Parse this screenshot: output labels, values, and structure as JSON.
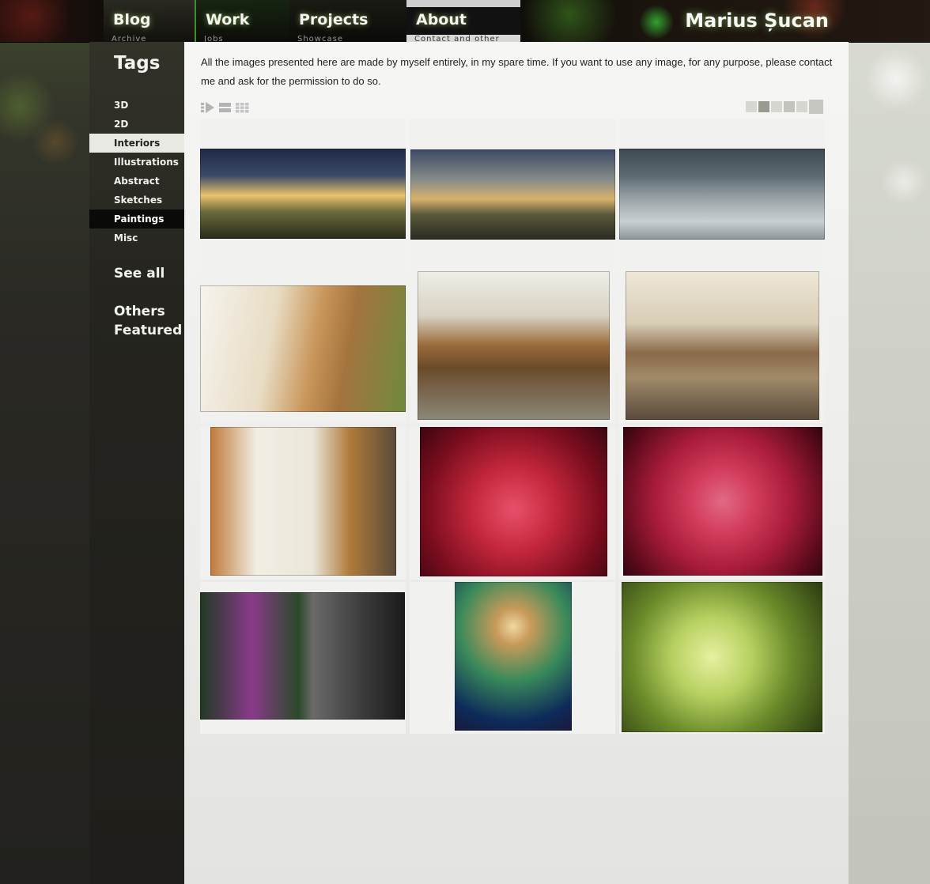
{
  "site": {
    "brand": "Marius Șucan"
  },
  "nav": {
    "items": [
      {
        "id": "blog",
        "label": "Blog",
        "strip": "Archive"
      },
      {
        "id": "work",
        "label": "Work",
        "strip": "Jobs"
      },
      {
        "id": "projects",
        "label": "Projects",
        "strip": "Showcase"
      },
      {
        "id": "about",
        "label": "About",
        "strip": "Contact and other"
      }
    ]
  },
  "sidebar": {
    "title": "Tags",
    "tags": [
      {
        "label": "3D",
        "state": "normal"
      },
      {
        "label": "2D",
        "state": "normal"
      },
      {
        "label": "Interiors",
        "state": "selected"
      },
      {
        "label": "Illustrations",
        "state": "normal"
      },
      {
        "label": "Abstract",
        "state": "normal"
      },
      {
        "label": "Sketches",
        "state": "normal"
      },
      {
        "label": "Paintings",
        "state": "hover"
      },
      {
        "label": "Misc",
        "state": "normal"
      }
    ],
    "see_all": "See all",
    "others_featured": "Others Featured"
  },
  "main": {
    "intro": "All the images presented here are made by myself entirely, in my spare time. If you want to use any image, for any purpose, please contact me and ask for the permission to do so.",
    "view_icons": [
      "slideshow-view-icon",
      "list-view-icon",
      "grid-view-icon"
    ],
    "thumb_sizes": {
      "count": 6,
      "selected_index": 1
    }
  },
  "gallery": {
    "thumbs": [
      {
        "name": "autumn-night-church-panorama",
        "palette": [
          "#1e2a45",
          "#6b6a3c",
          "#e9c36b",
          "#3a3a24"
        ]
      },
      {
        "name": "dusk-church-panorama",
        "palette": [
          "#3b4a66",
          "#8b8d88",
          "#d8b26b",
          "#3b3a2c"
        ]
      },
      {
        "name": "winter-church-panorama",
        "palette": [
          "#5e6a72",
          "#9aa3a6",
          "#c8d0d2",
          "#2f373c"
        ]
      },
      {
        "name": "dining-room-interior",
        "palette": [
          "#f2efe8",
          "#d9b98a",
          "#a4743e",
          "#6e8a3d"
        ]
      },
      {
        "name": "piano-room-interior",
        "palette": [
          "#ecebe4",
          "#9a6a3a",
          "#6a4a2a",
          "#8c8878"
        ]
      },
      {
        "name": "living-room-armchairs",
        "palette": [
          "#ece6d6",
          "#8a6a4a",
          "#a08a6a",
          "#5a4a3a"
        ]
      },
      {
        "name": "living-room-window",
        "palette": [
          "#eae6da",
          "#b07a3a",
          "#7a5a3e",
          "#5a4a3a"
        ]
      },
      {
        "name": "red-hearts-abstract",
        "palette": [
          "#7a0d1e",
          "#c2263b",
          "#e8506a",
          "#3a0610"
        ]
      },
      {
        "name": "red-rose-abstract",
        "palette": [
          "#5a0a1a",
          "#a81c3a",
          "#d43d5e",
          "#2e0610"
        ]
      },
      {
        "name": "fantasy-shoe-diptych",
        "palette": [
          "#2a4a2a",
          "#8a3a8a",
          "#6a6a6a",
          "#1a1a1a"
        ]
      },
      {
        "name": "glowing-mushroom",
        "palette": [
          "#0d2a5a",
          "#3a8a5a",
          "#c89a5a",
          "#1a1a3a"
        ]
      },
      {
        "name": "green-bubbles-abstract",
        "palette": [
          "#4a6a1a",
          "#b6d060",
          "#e8f0a0",
          "#2a3a10"
        ]
      }
    ]
  }
}
